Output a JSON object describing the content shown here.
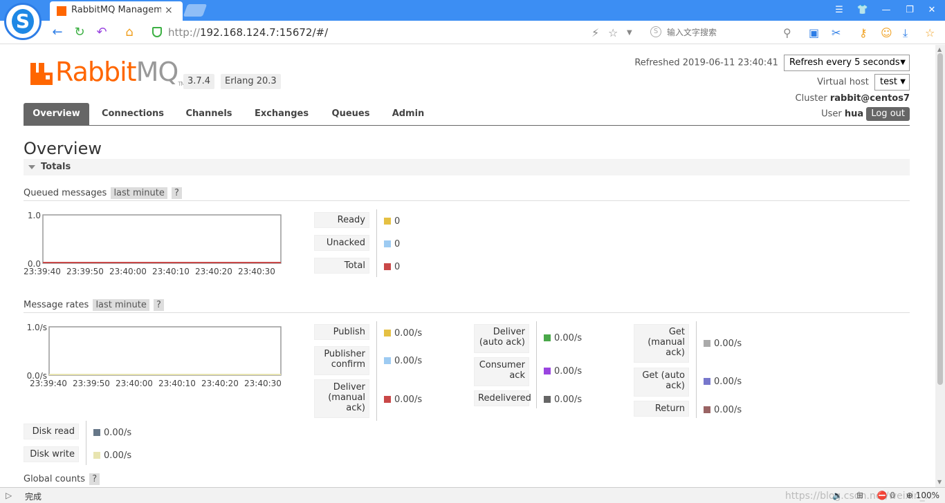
{
  "browser": {
    "tab_title": "RabbitMQ Management",
    "tab_close": "×",
    "url_protocol": "http://",
    "url_host": "192.168.124.7:15672/#/",
    "search_placeholder": "输入文字搜索",
    "logo_letter": "S"
  },
  "header": {
    "logo_word_1": "Rabbit",
    "logo_word_2": "MQ",
    "logo_tm": "TM",
    "version": "3.7.4",
    "erlang": "Erlang 20.3",
    "refreshed_label": "Refreshed 2019-06-11 23:40:41",
    "refresh_select": "Refresh every 5 seconds",
    "vhost_label": "Virtual host",
    "vhost_select": "test",
    "cluster_label": "Cluster",
    "cluster_value": "rabbit@centos7",
    "user_label": "User",
    "user_value": "hua",
    "logout_label": "Log out"
  },
  "nav": {
    "tabs": [
      {
        "label": "Overview",
        "active": true
      },
      {
        "label": "Connections"
      },
      {
        "label": "Channels"
      },
      {
        "label": "Exchanges"
      },
      {
        "label": "Queues"
      },
      {
        "label": "Admin"
      }
    ]
  },
  "main": {
    "title": "Overview",
    "totals_label": "Totals",
    "queued": {
      "title": "Queued messages",
      "range": "last minute",
      "help": "?",
      "chart_ymax": "1.0",
      "chart_ymin": "0.0",
      "x_ticks": [
        "23:39:40",
        "23:39:50",
        "23:40:00",
        "23:40:10",
        "23:40:20",
        "23:40:30"
      ],
      "legend": [
        {
          "label": "Ready",
          "value": "0",
          "color": "#e5c043"
        },
        {
          "label": "Unacked",
          "value": "0",
          "color": "#9dcbf2"
        },
        {
          "label": "Total",
          "value": "0",
          "color": "#c94848"
        }
      ]
    },
    "rates": {
      "title": "Message rates",
      "range": "last minute",
      "help": "?",
      "chart_ymax": "1.0/s",
      "chart_ymin": "0.0/s",
      "x_ticks": [
        "23:39:40",
        "23:39:50",
        "23:40:00",
        "23:40:10",
        "23:40:20",
        "23:40:30"
      ],
      "col1": [
        {
          "label": "Publish",
          "value": "0.00/s",
          "color": "#e5c043"
        },
        {
          "label": "Publisher confirm",
          "value": "0.00/s",
          "color": "#9dcbf2"
        },
        {
          "label": "Deliver (manual ack)",
          "value": "0.00/s",
          "color": "#c94848"
        }
      ],
      "col2": [
        {
          "label": "Deliver (auto ack)",
          "value": "0.00/s",
          "color": "#4aa84a"
        },
        {
          "label": "Consumer ack",
          "value": "0.00/s",
          "color": "#9a45e0"
        },
        {
          "label": "Redelivered",
          "value": "0.00/s",
          "color": "#666666"
        }
      ],
      "col3": [
        {
          "label": "Get (manual ack)",
          "value": "0.00/s",
          "color": "#aaaaaa"
        },
        {
          "label": "Get (auto ack)",
          "value": "0.00/s",
          "color": "#7777cc"
        },
        {
          "label": "Return",
          "value": "0.00/s",
          "color": "#9a6464"
        }
      ],
      "disk": [
        {
          "label": "Disk read",
          "value": "0.00/s",
          "color": "#667788"
        },
        {
          "label": "Disk write",
          "value": "0.00/s",
          "color": "#e8e4b0"
        }
      ]
    },
    "global_counts": {
      "title": "Global counts",
      "help": "?"
    }
  },
  "statusbar": {
    "status": "完成",
    "count": "0",
    "zoom": "100%",
    "watermark": "https://blog.csdn.net/weixin_..."
  },
  "chart_data": [
    {
      "type": "line",
      "title": "Queued messages",
      "x": [
        "23:39:40",
        "23:39:50",
        "23:40:00",
        "23:40:10",
        "23:40:20",
        "23:40:30"
      ],
      "ylim": [
        0.0,
        1.0
      ],
      "series": [
        {
          "name": "Ready",
          "values": [
            0,
            0,
            0,
            0,
            0,
            0
          ]
        },
        {
          "name": "Unacked",
          "values": [
            0,
            0,
            0,
            0,
            0,
            0
          ]
        },
        {
          "name": "Total",
          "values": [
            0,
            0,
            0,
            0,
            0,
            0
          ]
        }
      ]
    },
    {
      "type": "line",
      "title": "Message rates",
      "x": [
        "23:39:40",
        "23:39:50",
        "23:40:00",
        "23:40:10",
        "23:40:20",
        "23:40:30"
      ],
      "ylim": [
        0.0,
        1.0
      ],
      "series": [
        {
          "name": "Publish",
          "values": [
            0,
            0,
            0,
            0,
            0,
            0
          ]
        },
        {
          "name": "Disk write",
          "values": [
            0,
            0,
            0,
            0,
            0,
            0
          ]
        }
      ]
    }
  ]
}
